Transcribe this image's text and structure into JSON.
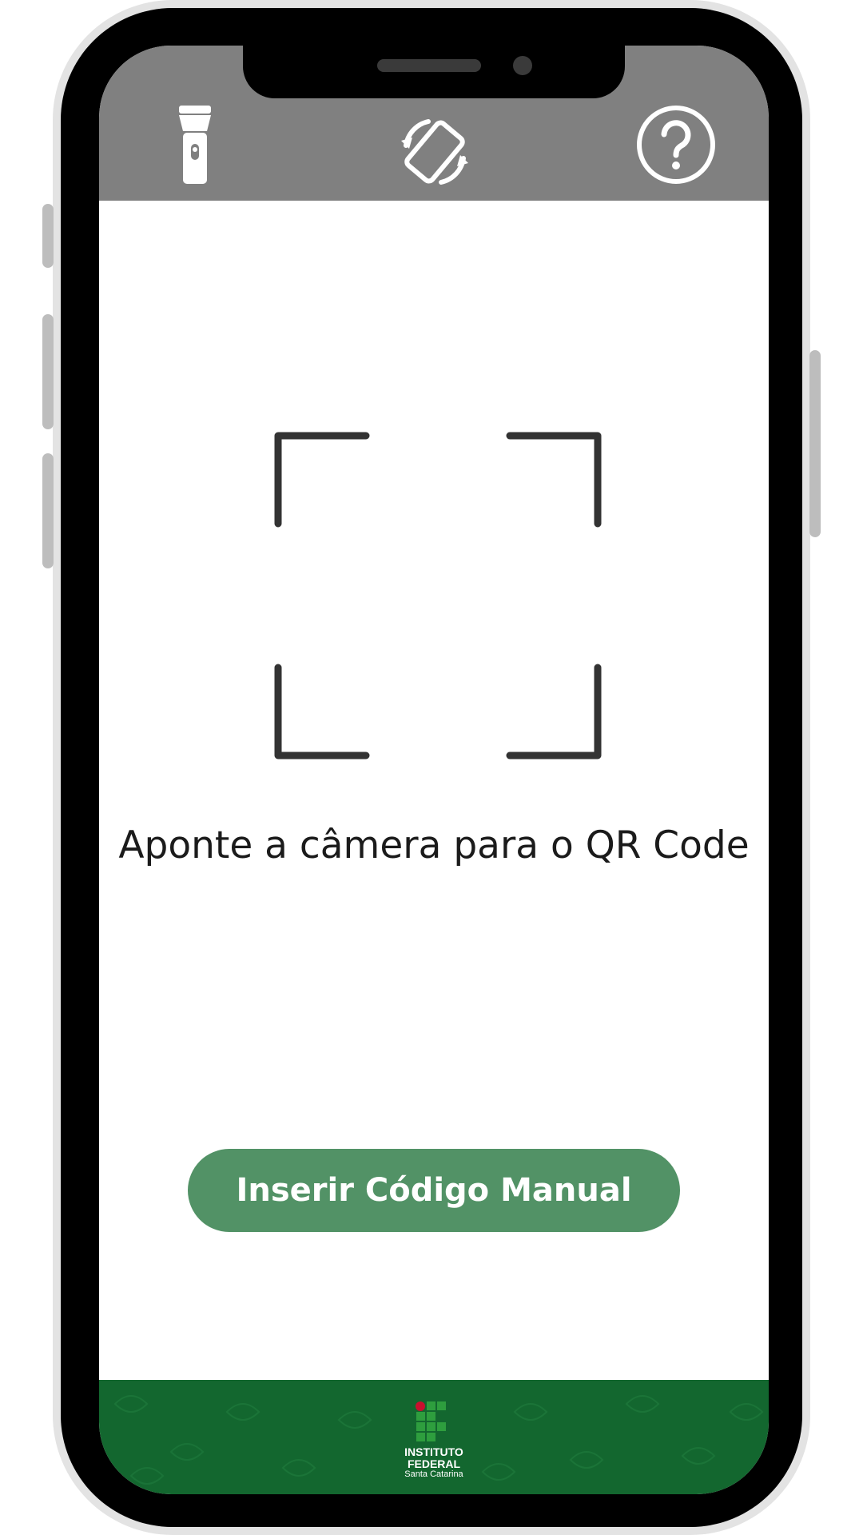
{
  "toolbar": {
    "flashlight_icon": "flashlight-icon",
    "rotate_icon": "rotate-screen-icon",
    "help_icon": "help-icon",
    "background": "#808080"
  },
  "scanner": {
    "instruction": "Aponte a câmera para o QR Code",
    "frame_color": "#333333"
  },
  "actions": {
    "manual_code_label": "Inserir Código Manual",
    "button_color": "#529266"
  },
  "footer": {
    "background": "#13672f",
    "logo_line1": "INSTITUTO",
    "logo_line2": "FEDERAL",
    "logo_line3": "Santa Catarina",
    "logo_accent": "#c8102e",
    "logo_green": "#2e9e3e"
  }
}
